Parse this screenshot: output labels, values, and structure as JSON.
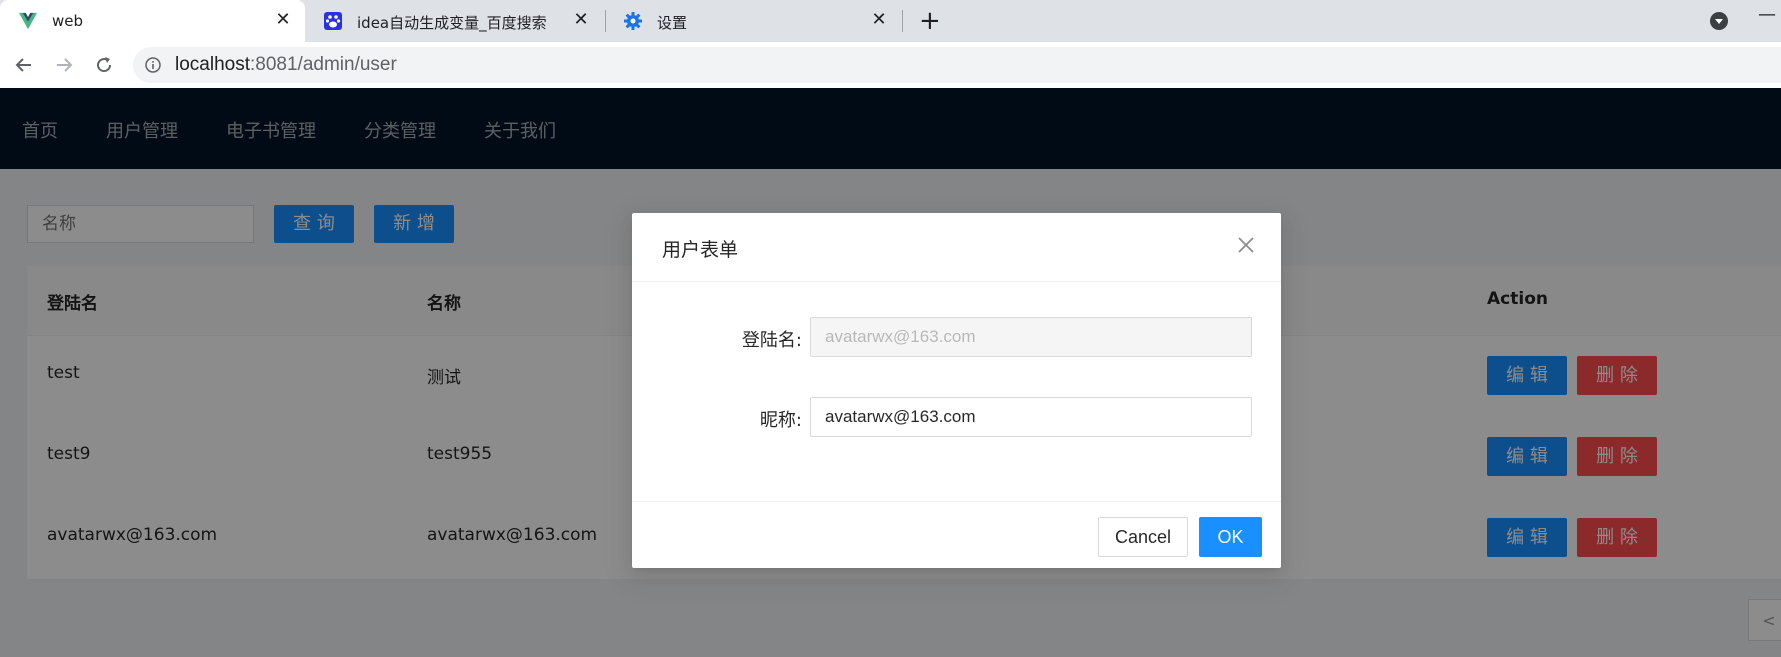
{
  "browser": {
    "tabs": [
      {
        "title": "web",
        "close": "✕"
      },
      {
        "title": "idea自动生成变量_百度搜索",
        "close": "✕"
      },
      {
        "title": "设置",
        "close": "✕"
      }
    ],
    "new_tab": "+",
    "url_host": "localhost",
    "url_rest": ":8081/admin/user"
  },
  "nav": {
    "items": [
      "首页",
      "用户管理",
      "电子书管理",
      "分类管理",
      "关于我们"
    ]
  },
  "toolbar": {
    "search_placeholder": "名称",
    "query_label": "查 询",
    "add_label": "新 增"
  },
  "table": {
    "headers": [
      "登陆名",
      "名称",
      "Action"
    ],
    "rows": [
      {
        "login": "test",
        "name": "测试"
      },
      {
        "login": "test9",
        "name": "test955"
      },
      {
        "login": "avatarwx@163.com",
        "name": "avatarwx@163.com"
      }
    ],
    "edit_label": "编 辑",
    "delete_label": "删 除"
  },
  "modal": {
    "title": "用户表单",
    "login_label": "登陆名:",
    "login_value": "avatarwx@163.com",
    "nickname_label": "昵称:",
    "nickname_value": "avatarwx@163.com",
    "cancel_label": "Cancel",
    "ok_label": "OK"
  },
  "colors": {
    "primary": "#1890ff",
    "danger": "#ff4d4f",
    "nav_bg": "#001529"
  }
}
